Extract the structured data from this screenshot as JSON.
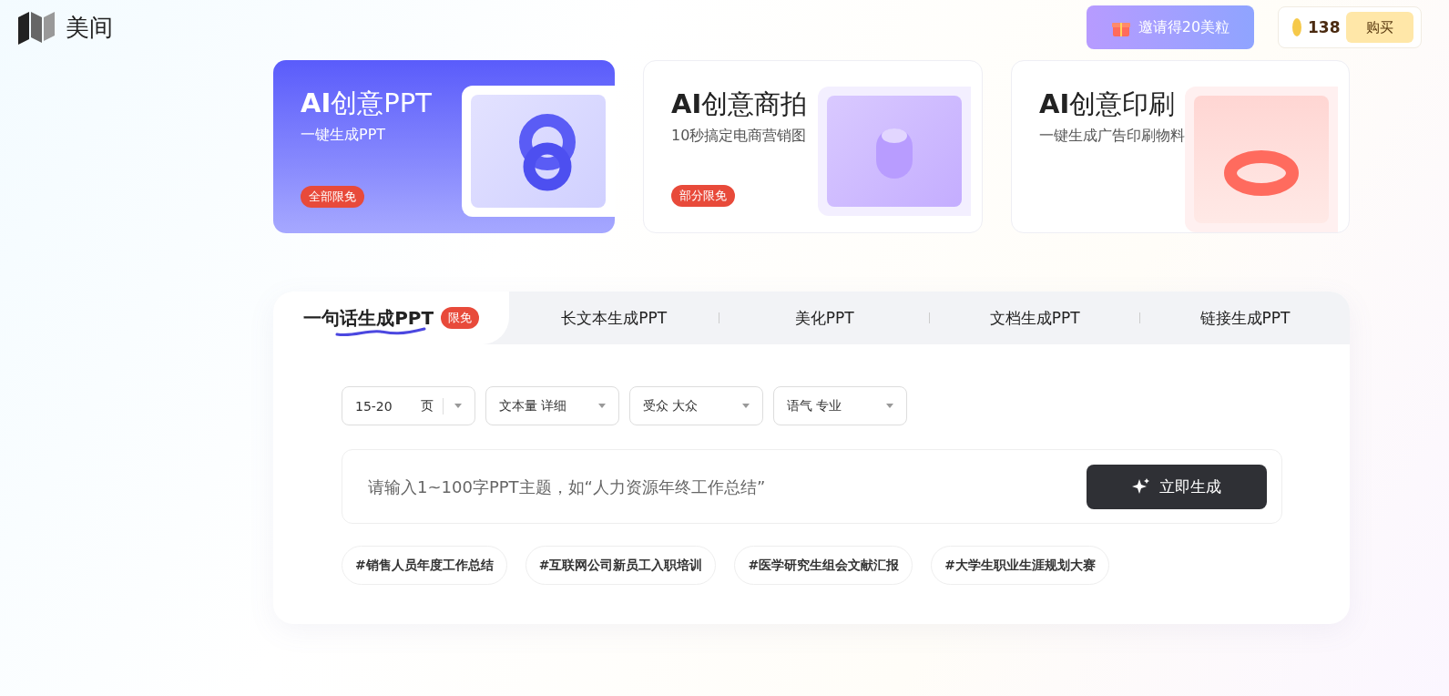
{
  "header": {
    "logo_text": "美间",
    "invite_button": "邀请得20美粒",
    "coins": "138",
    "buy_button": "购买"
  },
  "cards": [
    {
      "title": "**AI**创意PPT",
      "subtitle": "一键生成PPT",
      "badge": "全部限免",
      "kind": "primary"
    },
    {
      "title": "**AI**创意商拍",
      "subtitle": "10秒搞定电商营销图",
      "badge": "部分限免",
      "kind": "plain"
    },
    {
      "title": "**AI**创意印刷",
      "subtitle": "一键生成广告印刷物料",
      "kind": "plain"
    }
  ],
  "tabs": [
    {
      "label": "一句话生成PPT",
      "badge": "限免",
      "selected": true
    },
    {
      "label": "长文本生成PPT",
      "selected": false
    },
    {
      "label": "美化PPT",
      "selected": false
    },
    {
      "label": "文档生成PPT",
      "selected": false
    },
    {
      "label": "链接生成PPT",
      "selected": false
    }
  ],
  "options": [
    {
      "value": "15-20",
      "unit": "页"
    },
    {
      "label": "文本量",
      "value": "详细"
    },
    {
      "label": "受众",
      "value": "大众"
    },
    {
      "label": "语气",
      "value": "专业"
    }
  ],
  "prompt": {
    "placeholder": "请输入1~100字PPT主题，如“人力资源年终工作总结”",
    "button": "立即生成"
  },
  "tags": [
    "#销售人员年度工作总结",
    "#互联网公司新员工入职培训",
    "#医学研究生组会文献汇报",
    "#大学生职业生涯规划大赛"
  ]
}
